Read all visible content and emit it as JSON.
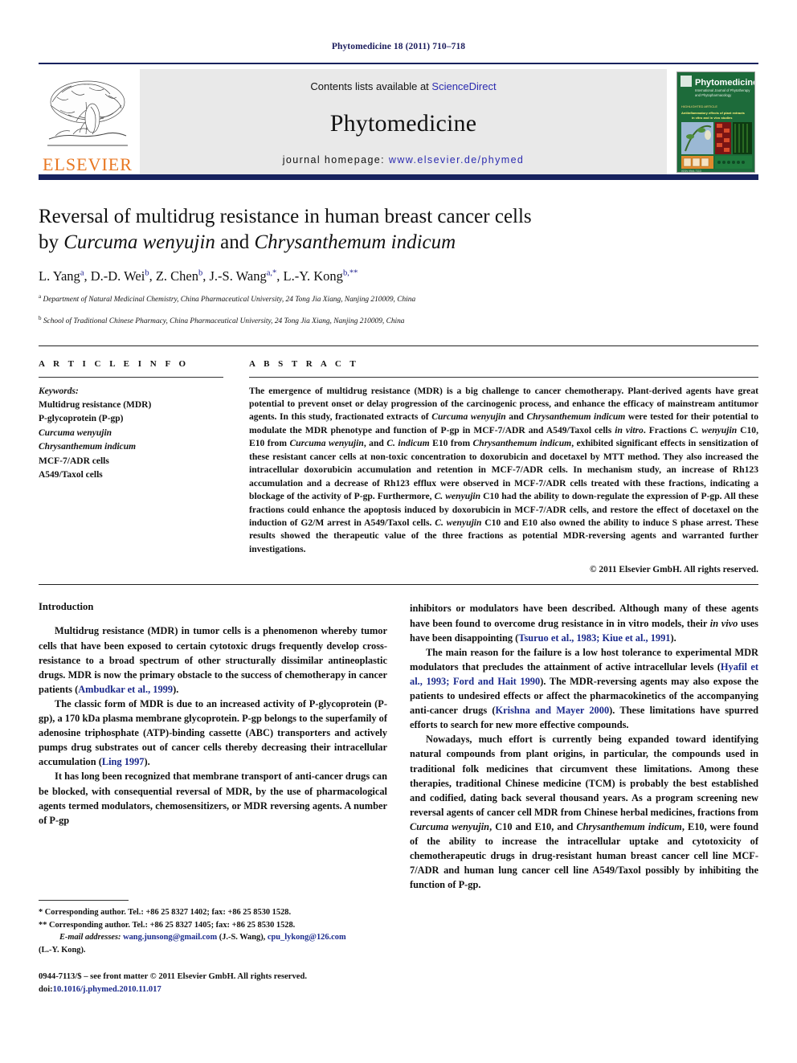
{
  "running_head": "Phytomedicine 18 (2011) 710–718",
  "masthead": {
    "contents_prefix": "Contents lists available at ",
    "sciencedirect": "ScienceDirect",
    "journal_name": "Phytomedicine",
    "homepage_prefix": "journal homepage: ",
    "homepage_url": "www.elsevier.de/phymed",
    "publisher_wordmark": "ELSEVIER",
    "cover_title": "Phytomedicine",
    "accent_link_color": "#2b2bb0",
    "elsevier_orange": "#e87722",
    "masthead_navy": "#17225e"
  },
  "article": {
    "title_line1": "Reversal of multidrug resistance in human breast cancer cells",
    "title_line2_prefix": "by ",
    "title_line2_italic1": "Curcuma wenyujin",
    "title_line2_mid": " and ",
    "title_line2_italic2": "Chrysanthemum indicum",
    "authors": "L. Yang a, D.-D. Wei b, Z. Chen b, J.-S. Wang a,*, L.-Y. Kong b,**",
    "affiliation_a": "Department of Natural Medicinal Chemistry, China Pharmaceutical University, 24 Tong Jia Xiang, Nanjing 210009, China",
    "affiliation_b": "School of Traditional Chinese Pharmacy, China Pharmaceutical University, 24 Tong Jia Xiang, Nanjing 210009, China"
  },
  "article_info": {
    "heading": "A R T I C L E   I N F O",
    "keywords_label": "Keywords:",
    "keywords": [
      "Multidrug resistance (MDR)",
      "P-glycoprotein (P-gp)",
      "Curcuma wenyujin",
      "Chrysanthemum indicum",
      "MCF-7/ADR cells",
      "A549/Taxol cells"
    ]
  },
  "abstract": {
    "heading": "A B S T R A C T",
    "text_1": "The emergence of multidrug resistance (MDR) is a big challenge to cancer chemotherapy. Plant-derived agents have great potential to prevent onset or delay progression of the carcinogenic process, and enhance the efficacy of mainstream antitumor agents. In this study, fractionated extracts of ",
    "italic_1": "Curcuma wenyujin",
    "text_2": " and ",
    "italic_2": "Chrysanthemum indicum",
    "text_3": " were tested for their potential to modulate the MDR phenotype and function of P-gp in MCF-7/ADR and A549/Taxol cells ",
    "italic_3": "in vitro",
    "text_4": ". Fractions ",
    "italic_4": "C. wenyujin",
    "text_5": " C10, E10 from ",
    "italic_5": "Curcuma wenyujin",
    "text_6": ", and ",
    "italic_6": "C. indicum",
    "text_7": " E10 from ",
    "italic_7": "Chrysanthemum indicum",
    "text_8": ", exhibited significant effects in sensitization of these resistant cancer cells at non-toxic concentration to doxorubicin and docetaxel by MTT method. They also increased the intracellular doxorubicin accumulation and retention in MCF-7/ADR cells. In mechanism study, an increase of Rh123 accumulation and a decrease of Rh123 efflux were observed in MCF-7/ADR cells treated with these fractions, indicating a blockage of the activity of P-gp. Furthermore, ",
    "italic_8": "C. wenyujin",
    "text_9": " C10 had the ability to down-regulate the expression of P-gp. All these fractions could enhance the apoptosis induced by doxorubicin in MCF-7/ADR cells, and restore the effect of docetaxel on the induction of G2/M arrest in A549/Taxol cells. ",
    "italic_9": "C. wenyujin",
    "text_10": " C10 and E10 also owned the ability to induce S phase arrest. These results showed the therapeutic value of the three fractions as potential MDR-reversing agents and warranted further investigations.",
    "copyright": "© 2011 Elsevier GmbH. All rights reserved."
  },
  "body": {
    "intro_heading": "Introduction",
    "left": {
      "p1_a": "Multidrug resistance (MDR) in tumor cells is a phenomenon whereby tumor cells that have been exposed to certain cytotoxic drugs frequently develop cross-resistance to a broad spectrum of other structurally dissimilar antineoplastic drugs. MDR is now the primary obstacle to the success of chemotherapy in cancer patients (",
      "p1_cite": "Ambudkar et al., 1999",
      "p1_b": ").",
      "p2_a": "The classic form of MDR is due to an increased activity of P-glycoprotein (P-gp), a 170 kDa plasma membrane glycoprotein. P-gp belongs to the superfamily of adenosine triphosphate (ATP)-binding cassette (ABC) transporters and actively pumps drug substrates out of cancer cells thereby decreasing their intracellular accumulation (",
      "p2_cite": "Ling 1997",
      "p2_b": ").",
      "p3": "It has long been recognized that membrane transport of anti-cancer drugs can be blocked, with consequential reversal of MDR, by the use of pharmacological agents termed modulators, chemosensitizers, or MDR reversing agents. A number of P-gp"
    },
    "right": {
      "p1_a": "inhibitors or modulators have been described. Although many of these agents have been found to overcome drug resistance in in vitro models, their ",
      "p1_italic": "in vivo",
      "p1_b": " uses have been disappointing (",
      "p1_cite": "Tsuruo et al., 1983; Kiue et al., 1991",
      "p1_c": ").",
      "p2_a": "The main reason for the failure is a low host tolerance to experimental MDR modulators that precludes the attainment of active intracellular levels (",
      "p2_cite1": "Hyafil et al., 1993; Ford and Hait 1990",
      "p2_b": "). The MDR-reversing agents may also expose the patients to undesired effects or affect the pharmacokinetics of the accompanying anti-cancer drugs (",
      "p2_cite2": "Krishna and Mayer 2000",
      "p2_c": "). These limitations have spurred efforts to search for new more effective compounds.",
      "p3_a": "Nowadays, much effort is currently being expanded toward identifying natural compounds from plant origins, in particular, the compounds used in traditional folk medicines that circumvent these limitations. Among these therapies, traditional Chinese medicine (TCM) is probably the best established and codified, dating back several thousand years. As a program screening new reversal agents of cancer cell MDR from Chinese herbal medicines, fractions from ",
      "p3_italic1": "Curcuma wenyujin",
      "p3_b": ", C10 and E10, and ",
      "p3_italic2": "Chrysanthemum indicum",
      "p3_c": ", E10, were found of the ability to increase the intracellular uptake and cytotoxicity of chemotherapeutic drugs in drug-resistant human breast cancer cell line MCF-7/ADR and human lung cancer cell line A549/Taxol possibly by inhibiting the function of P-gp."
    }
  },
  "footnotes": {
    "fn1": "* Corresponding author. Tel.: +86 25 8327 1402; fax: +86 25 8530 1528.",
    "fn2": "** Corresponding author. Tel.: +86 25 8327 1405; fax: +86 25 8530 1528.",
    "email_label": "E-mail addresses:",
    "email1": "wang.junsong@gmail.com",
    "email1_who": " (J.-S. Wang), ",
    "email2": "cpu_lykong@126.com",
    "email2_who": "(L.-Y. Kong).",
    "imprint_line1": "0944-7113/$ – see front matter © 2011 Elsevier GmbH. All rights reserved.",
    "imprint_doi_label": "doi:",
    "imprint_doi": "10.1016/j.phymed.2010.11.017"
  }
}
